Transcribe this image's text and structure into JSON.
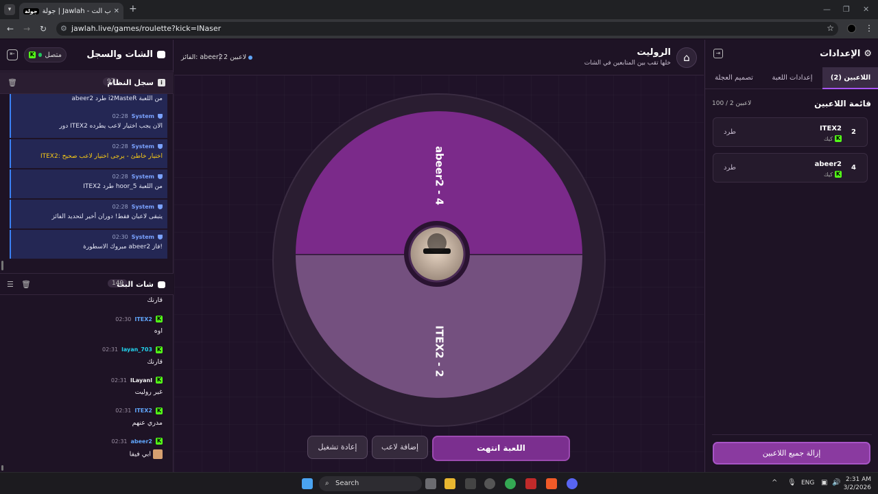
{
  "browser": {
    "tab_title": "جولة | Jawlah - منصة الألعاب الت",
    "tab_badge": "جولة",
    "url": "jawlah.live/games/roulette?kick=INaser"
  },
  "left": {
    "title": "الشات والسجل",
    "connection": "متصل",
    "system_log": {
      "title": "سجل النظام",
      "count": "97",
      "first_msg": "abeer2 طرد i2MasteR من اللعبة",
      "messages": [
        {
          "sender": "System",
          "time": "02:28",
          "text": "دور ITEX2 الان يجب اختيار لاعب يطرده",
          "warn": false
        },
        {
          "sender": "System",
          "time": "02:28",
          "text": "ITEX2: اختيار خاطئ - يرجى اختيار لاعب صحيح",
          "warn": true
        },
        {
          "sender": "System",
          "time": "02:28",
          "text": "ITEX2 طرد hoor_5 من اللعبة",
          "warn": false
        },
        {
          "sender": "System",
          "time": "02:28",
          "text": "يتبقى لاعبان فقط! دوران أخير لتحديد الفائز",
          "warn": false
        },
        {
          "sender": "System",
          "time": "02:30",
          "text": "مبروك الاسطورة abeer2 فاز!",
          "warn": false
        }
      ]
    },
    "stream_chat": {
      "title": "شات البث",
      "count": "149",
      "first_text": "قارنك",
      "messages": [
        {
          "user": "ITEX2",
          "time": "02:30",
          "text": "اوه",
          "color": "#60a5fa"
        },
        {
          "user": "layan_703",
          "time": "02:31",
          "text": "قارنك",
          "color": "#22d3ee"
        },
        {
          "user": "lLayanl",
          "time": "02:31",
          "text": "غير روليت",
          "color": "#f2f2f2"
        },
        {
          "user": "ITEX2",
          "time": "02:31",
          "text": "مدري عنهم",
          "color": "#60a5fa"
        },
        {
          "user": "abeer2",
          "time": "02:31",
          "text": "ابي فيفا",
          "color": "#60a5fa"
        }
      ]
    }
  },
  "game": {
    "title": "الروليت",
    "subtitle": "خلها تقب بين المتابعين في الشات",
    "player_count": "2 لاعبين",
    "winner": "الفائز: abeer2",
    "wheel": {
      "segments": [
        {
          "label": "abeer2 - 4",
          "color": "#7b2a8a"
        },
        {
          "label": "ITEX2 - 2",
          "color": "#74507f"
        }
      ]
    },
    "buttons": {
      "ended": "اللعبة انتهت",
      "add_player": "إضافة لاعب",
      "restart": "إعادة تشغيل"
    }
  },
  "settings": {
    "title": "الإعدادات",
    "tabs": [
      "اللاعبين (2)",
      "إعدادات اللعبة",
      "تصميم العجلة"
    ],
    "list_title": "قائمة اللاعبين",
    "list_count": "100 / 2 لاعبين",
    "players": [
      {
        "num": "2",
        "name": "ITEX2",
        "platform": "كيك",
        "action": "طرد"
      },
      {
        "num": "4",
        "name": "abeer2",
        "platform": "كيك",
        "action": "طرد"
      }
    ],
    "remove_all": "إزالة جميع اللاعبين"
  },
  "taskbar": {
    "search": "Search",
    "lang": "ENG",
    "time": "2:31 AM",
    "date": "3/2/2026"
  },
  "colors": {
    "accent": "#8a3aa0",
    "kick_green": "#53fc18",
    "system_blue": "#3b82f6"
  }
}
